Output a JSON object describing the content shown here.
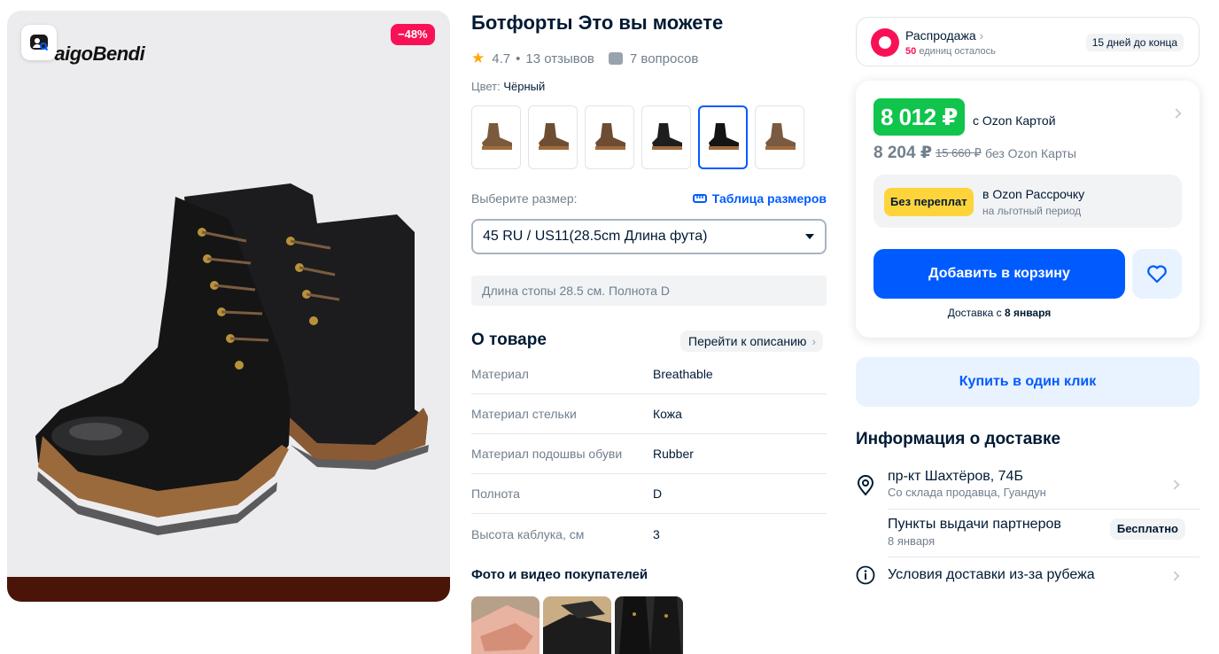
{
  "gallery": {
    "brand": "DaigoBendi",
    "discount": "−48%"
  },
  "product": {
    "title": "Ботфорты Это вы можете",
    "rating": "4.7",
    "reviews": "13 отзывов",
    "questions": "7 вопросов",
    "color_label": "Цвет:",
    "color_value": "Чёрный",
    "thumb_count": 6,
    "selected_thumb": 5
  },
  "size": {
    "label": "Выберите размер:",
    "table_link": "Таблица размеров",
    "selected": "45 RU / US11(28.5cm Длина фута)",
    "foot_note": "Длина стопы 28.5 см. Полнота D"
  },
  "about": {
    "title": "О товаре",
    "to_description": "Перейти к описанию",
    "specs": [
      {
        "key": "Материал",
        "value": "Breathable"
      },
      {
        "key": "Материал стельки",
        "value": "Кожа"
      },
      {
        "key": "Материал подошвы обуви",
        "value": "Rubber"
      },
      {
        "key": "Полнота",
        "value": "D"
      },
      {
        "key": "Высота каблука, см",
        "value": "3"
      }
    ]
  },
  "customer_photos": {
    "title": "Фото и видео покупателей"
  },
  "sale": {
    "title": "Распродажа",
    "remaining_count": "50",
    "remaining_text": "единиц осталось",
    "days_left": "15 дней до конца"
  },
  "price": {
    "card_price": "8 012 ₽",
    "card_note": "с Ozon Картой",
    "regular_price": "8 204 ₽",
    "old_price": "15 660 ₽",
    "regular_note": "без Ozon Карты",
    "installment_badge": "Без переплат",
    "installment_title": "в Ozon Рассрочку",
    "installment_sub": "на льготный период",
    "add_to_cart": "Добавить в корзину",
    "delivery_prefix": "Доставка с",
    "delivery_date": "8 января"
  },
  "one_click": "Купить в один клик",
  "delivery": {
    "title": "Информация о доставке",
    "address": "пр-кт Шахтёров, 74Б",
    "address_sub": "Со склада продавца, Гуандун",
    "pickup": "Пункты выдачи партнеров",
    "pickup_date": "8 января",
    "pickup_price": "Бесплатно",
    "conditions": "Условия доставки из-за рубежа"
  },
  "colors": {
    "accent": "#005bff",
    "price_green": "#10c44c",
    "sale_pink": "#f91155",
    "installment_yellow": "#ffd43b"
  }
}
